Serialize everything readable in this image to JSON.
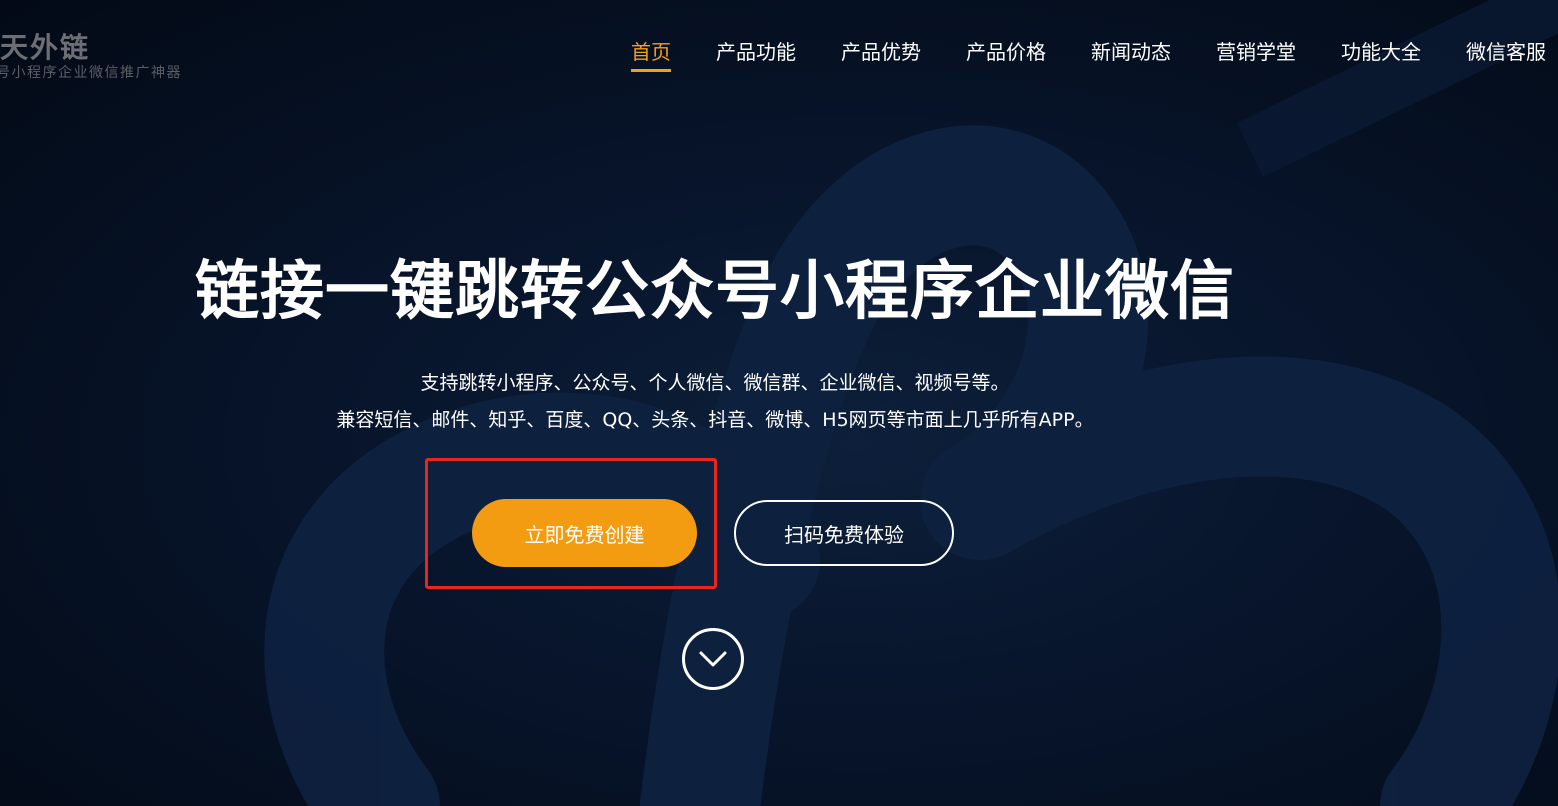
{
  "logo": {
    "title": "天外链",
    "subtitle": "号小程序企业微信推广神器"
  },
  "nav": {
    "items": [
      {
        "label": "首页",
        "active": true
      },
      {
        "label": "产品功能",
        "active": false
      },
      {
        "label": "产品优势",
        "active": false
      },
      {
        "label": "产品价格",
        "active": false
      },
      {
        "label": "新闻动态",
        "active": false
      },
      {
        "label": "营销学堂",
        "active": false
      },
      {
        "label": "功能大全",
        "active": false
      },
      {
        "label": "微信客服",
        "active": false
      }
    ]
  },
  "hero": {
    "title": "链接一键跳转公众号小程序企业微信",
    "subtitle_line1": "支持跳转小程序、公众号、个人微信、微信群、企业微信、视频号等。",
    "subtitle_line2": "兼容短信、邮件、知乎、百度、QQ、头条、抖音、微博、H5网页等市面上几乎所有APP。",
    "primary_button": "立即免费创建",
    "secondary_button": "扫码免费体验"
  },
  "colors": {
    "accent": "#f39c12",
    "highlight": "#e8261f",
    "background": "#05101f"
  },
  "icons": {
    "scroll": "chevron-down-icon"
  }
}
